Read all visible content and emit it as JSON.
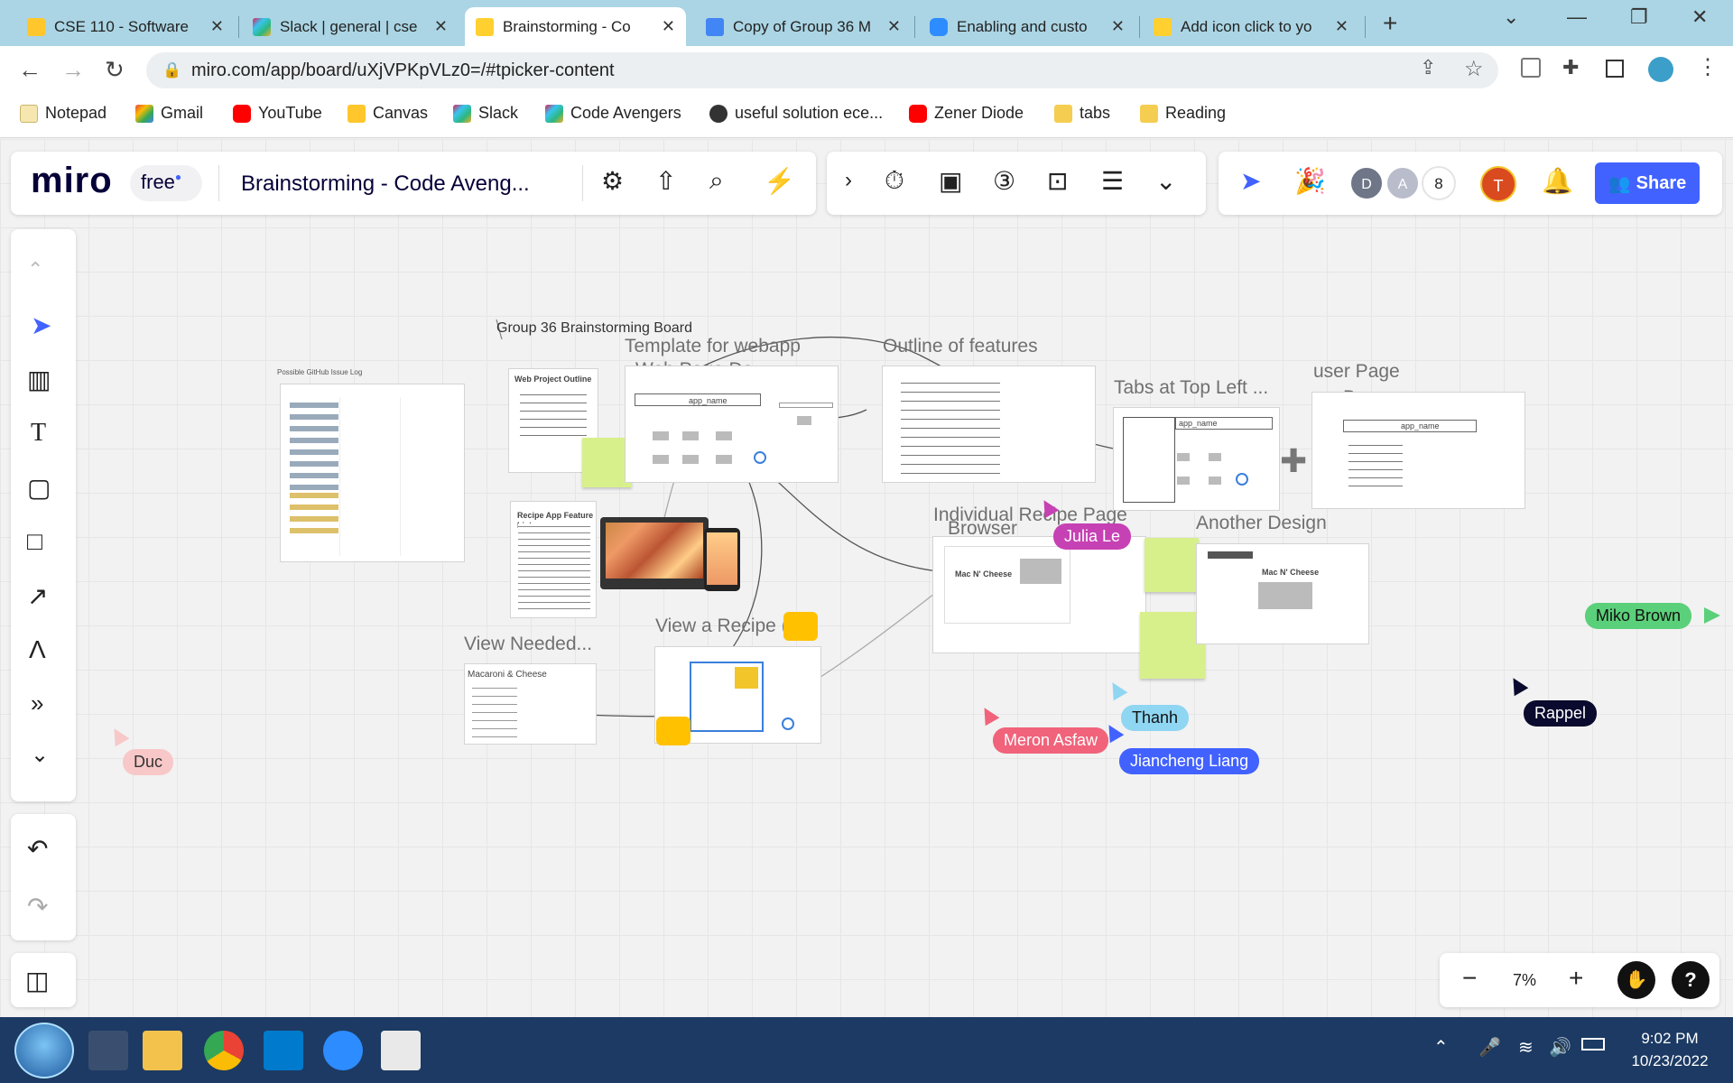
{
  "browser": {
    "tabs": [
      {
        "label": "CSE 110 - Software",
        "color": "#0b1e30"
      },
      {
        "label": "Slack | general | cse",
        "color": "#4a154b"
      },
      {
        "label": "Brainstorming - Co",
        "color": "#050038"
      },
      {
        "label": "Copy of Group 36 M",
        "color": "#4285f4"
      },
      {
        "label": "Enabling and custo",
        "color": "#2d8cff"
      },
      {
        "label": "Add icon click to yo",
        "color": "#050038"
      }
    ],
    "url": "miro.com/app/board/uXjVPKpVLz0=/#tpicker-content",
    "bookmarks": [
      "Notepad",
      "Gmail",
      "YouTube",
      "Canvas",
      "Slack",
      "Code Avengers",
      "useful solution ece...",
      "Zener Diode",
      "tabs",
      "Reading"
    ]
  },
  "miro": {
    "logo": "miro",
    "plan": "free",
    "board_title": "Brainstorming - Code Aveng...",
    "collab_count": "8",
    "avatar_d": "D",
    "avatar_a": "A",
    "avatar_t": "T",
    "share_label": "Share",
    "zoom": "7%",
    "help": "?"
  },
  "board": {
    "heading": "Group 36 Brainstorming Board",
    "github_log": "Possible GitHub Issue Log",
    "frames": {
      "template": "Template for webapp",
      "webpage": "Web Page De...",
      "outline": "Outline of features",
      "tabs": "Tabs at Top Left ...",
      "userpage": "user Page",
      "browser1": "Browser",
      "recipe": "Individual Recipe Page",
      "browser2": "Browser",
      "another": "Another Design",
      "viewneeded": "View Needed...",
      "viewrecipe": "View a Recipe (",
      "macaroni": "Macaroni & Cheese",
      "mac_cheese": "Mac N' Cheese",
      "app_name": "app_name",
      "web_outline": "Web Project Outline",
      "feature_list": "Recipe App Feature List:"
    },
    "cursors": [
      {
        "name": "Julia Le",
        "color": "#c641b3"
      },
      {
        "name": "Miko Brown",
        "color": "#5bd07a"
      },
      {
        "name": "Thanh",
        "color": "#8fd6f2"
      },
      {
        "name": "Rappel",
        "color": "#0a0a2e"
      },
      {
        "name": "Meron Asfaw",
        "color": "#f0637a"
      },
      {
        "name": "Jiancheng Liang",
        "color": "#4262ff"
      },
      {
        "name": "Duc",
        "color": "#f8c8c8"
      }
    ]
  },
  "taskbar": {
    "time": "9:02 PM",
    "date": "10/23/2022"
  }
}
